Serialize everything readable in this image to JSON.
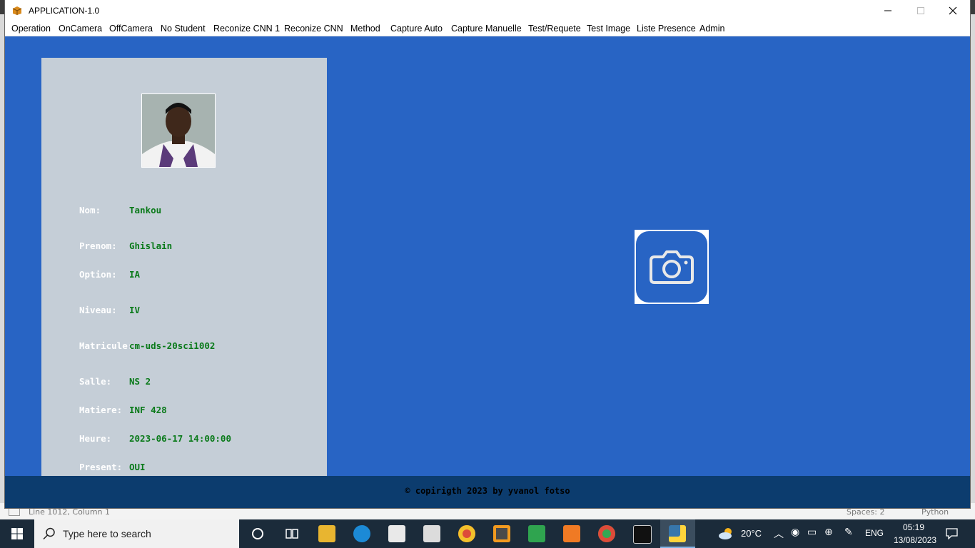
{
  "window": {
    "title": "APPLICATION-1.0"
  },
  "menu": [
    "Operation",
    "OnCamera",
    "OffCamera",
    "No Student",
    "Reconize CNN 1",
    "Reconize CNN",
    "Method",
    "Capture Auto",
    "Capture Manuelle",
    "Test/Requete",
    "Test Image",
    "Liste Presence",
    "Admin"
  ],
  "student": {
    "fields": [
      {
        "label": "Nom:",
        "value": "Tankou"
      },
      {
        "label": "Prenom:",
        "value": "Ghislain"
      },
      {
        "label": "Option:",
        "value": "IA"
      },
      {
        "label": "Niveau:",
        "value": "IV"
      },
      {
        "label": "Matricule:",
        "value": "cm-uds-20sci1002"
      },
      {
        "label": "Salle:",
        "value": "NS 2"
      },
      {
        "label": "Matiere:",
        "value": "INF 428"
      },
      {
        "label": "Heure:",
        "value": "2023-06-17 14:00:00"
      },
      {
        "label": "Present:",
        "value": "OUI"
      }
    ]
  },
  "footer": {
    "text": "© copirigth 2023 by yvanol fotso"
  },
  "editor_status": {
    "position": "Line 1012, Column 1",
    "spaces": "Spaces: 2",
    "language": "Python"
  },
  "taskbar": {
    "search_placeholder": "Type here to search",
    "weather": "20°C",
    "language": "ENG",
    "time": "05:19",
    "date": "13/08/2023"
  },
  "colors": {
    "app_background": "#2864c4",
    "panel": "#c5ced7",
    "value_text": "#0a7a1a",
    "footer": "#0c3c6e",
    "taskbar": "#1b2b3a"
  }
}
